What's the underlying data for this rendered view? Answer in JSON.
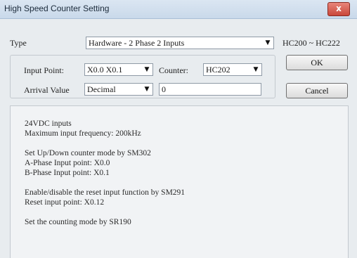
{
  "window": {
    "title": "High Speed Counter Setting",
    "close_glyph": "x"
  },
  "type_row": {
    "label": "Type",
    "selected": "Hardware - 2 Phase 2 Inputs",
    "range_text": "HC200 ~ HC222"
  },
  "input_point": {
    "label": "Input Point:",
    "selected": "X0.0 X0.1"
  },
  "counter": {
    "label": "Counter:",
    "selected": "HC202"
  },
  "arrival_value": {
    "label": "Arrival Value",
    "format_selected": "Decimal",
    "value": "0"
  },
  "buttons": {
    "ok_label": "OK",
    "cancel_label": "Cancel"
  },
  "info_lines": [
    "24VDC inputs",
    "Maximum input frequency: 200kHz",
    "Set Up/Down counter mode by SM302",
    "A-Phase Input point: X0.0",
    "B-Phase Input point: X0.1",
    "Enable/disable the reset input function by SM291",
    "Reset input point: X0.12",
    "Set the counting mode by SR190"
  ]
}
